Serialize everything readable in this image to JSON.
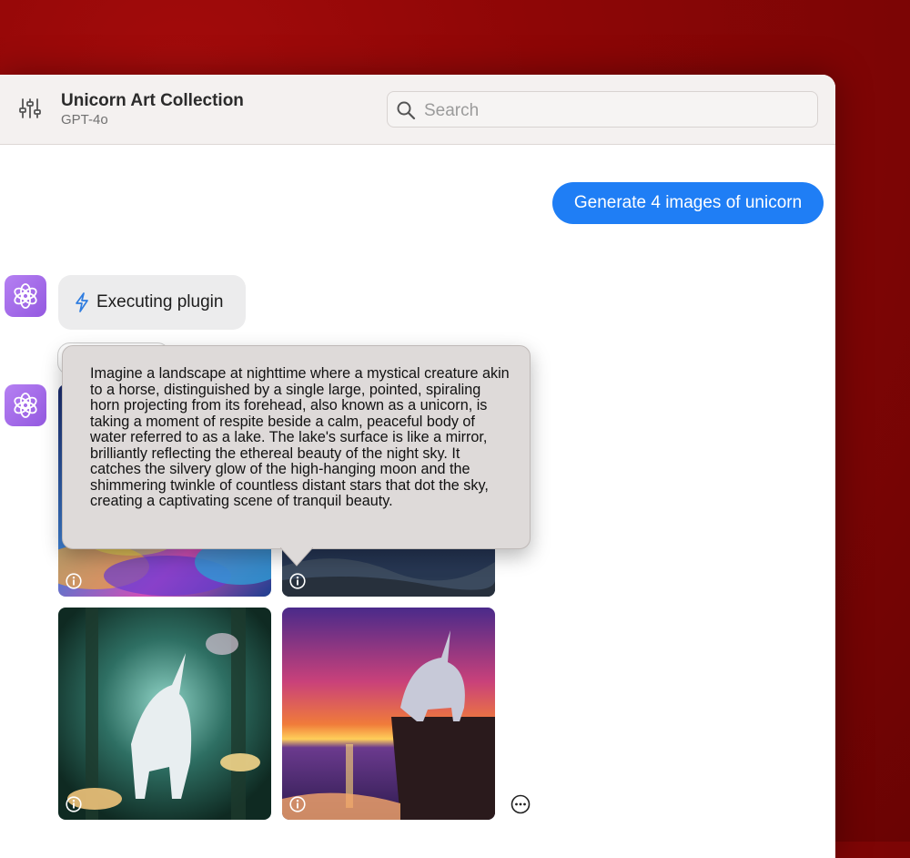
{
  "window": {
    "title": "Unicorn Art Collection",
    "model": "GPT-4o",
    "settings_icon": "sliders-icon"
  },
  "search": {
    "placeholder": "Search",
    "value": "",
    "icon": "search-icon"
  },
  "messages": {
    "user_prompt": "Generate 4 images of unicorn",
    "assistant_status": "Executing plugin",
    "status_icon": "bolt-icon",
    "avatar_icon": "openai-logo-icon"
  },
  "tooltip": {
    "text": "Imagine a landscape at nighttime where a mystical creature akin to a horse, distinguished by a single large, pointed, spiraling horn projecting from its forehead, also known as a unicorn, is taking a moment of respite beside a calm, peaceful body of water referred to as a lake. The lake's surface is like a mirror, brilliantly reflecting the ethereal beauty of the night sky. It catches the silvery glow of the high-hanging moon and the shimmering twinkle of countless distant stars that dot the sky, creating a captivating scene of tranquil beauty."
  },
  "images": [
    {
      "subject": "rainbow-clouds-unicorn",
      "info_icon": "info-icon"
    },
    {
      "subject": "night-lake-unicorn",
      "info_icon": "info-icon"
    },
    {
      "subject": "enchanted-forest-unicorn",
      "info_icon": "info-icon"
    },
    {
      "subject": "sunset-cliff-unicorn",
      "info_icon": "info-icon"
    }
  ],
  "actions": {
    "more_icon": "more-options-icon"
  },
  "colors": {
    "accent_blue": "#1f7ef5",
    "avatar_purple": "#a36cea",
    "background_red": "#8e0606"
  }
}
